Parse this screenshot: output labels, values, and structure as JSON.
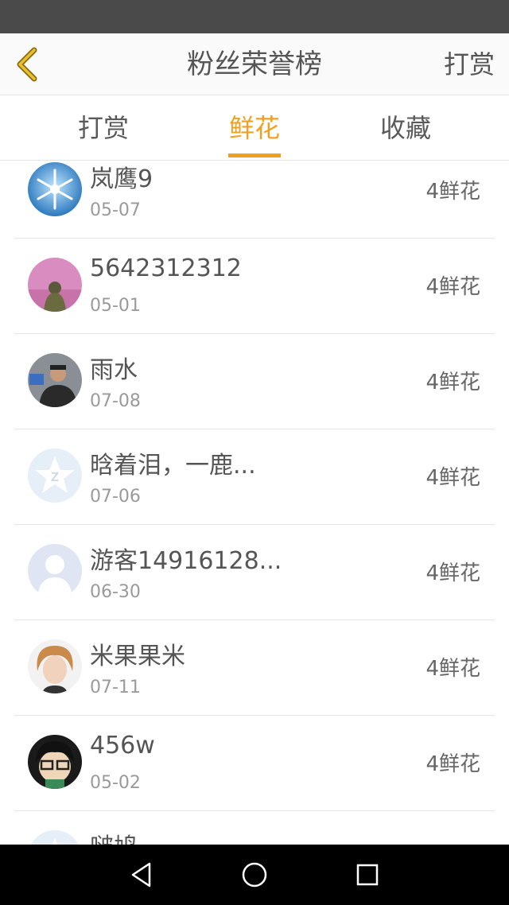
{
  "header": {
    "title": "粉丝荣誉榜",
    "action_label": "打赏"
  },
  "tabs": [
    {
      "label": "打赏",
      "active": false
    },
    {
      "label": "鲜花",
      "active": true
    },
    {
      "label": "收藏",
      "active": false
    }
  ],
  "colors": {
    "accent": "#f0a020",
    "text": "#555555",
    "muted": "#9a9a9a",
    "status_bar": "#4a4a4a"
  },
  "list": [
    {
      "name": "岚鹰9",
      "date": "05-07",
      "amount": "4鲜花",
      "avatar": "snowflake-avatar"
    },
    {
      "name": "5642312312",
      "date": "05-01",
      "amount": "4鲜花",
      "avatar": "pink-couple-avatar"
    },
    {
      "name": "雨水",
      "date": "07-08",
      "amount": "4鲜花",
      "avatar": "man-photo-avatar"
    },
    {
      "name": "晗着泪，一鹿...",
      "date": "07-06",
      "amount": "4鲜花",
      "avatar": "qzone-default-avatar"
    },
    {
      "name": "游客14916128...",
      "date": "06-30",
      "amount": "4鲜花",
      "avatar": "default-person-avatar"
    },
    {
      "name": "米果果米",
      "date": "07-11",
      "amount": "4鲜花",
      "avatar": "boy-photo-avatar"
    },
    {
      "name": "456w",
      "date": "05-02",
      "amount": "4鲜花",
      "avatar": "cartoon-glasses-avatar"
    },
    {
      "name": "啵鸠",
      "date": "",
      "amount": "",
      "avatar": "qzone-default-avatar"
    }
  ]
}
